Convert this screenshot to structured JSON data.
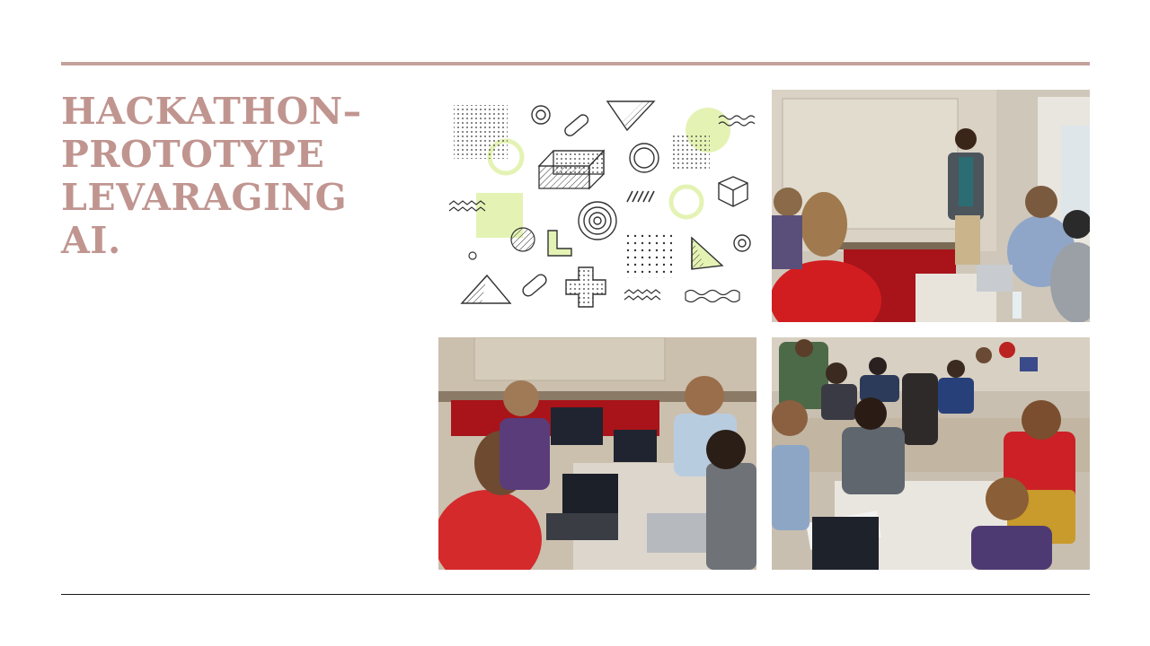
{
  "slide": {
    "title_lines": [
      "HACKATHON–",
      "PROTOTYPE",
      "LEVARAGING",
      "AI."
    ]
  },
  "colors": {
    "title": "#c09590",
    "top_rule": "#c4a29c",
    "bottom_rule": "#1a1a1a",
    "accent_green": "#e4f3b4"
  },
  "images": {
    "decorative": "geometric-shapes-illustration",
    "photo_1": "presenter-speaking-to-seated-group-photo",
    "photo_2": "students-with-laptops-at-table-photo",
    "photo_3": "room-of-teams-working-at-tables-photo"
  }
}
